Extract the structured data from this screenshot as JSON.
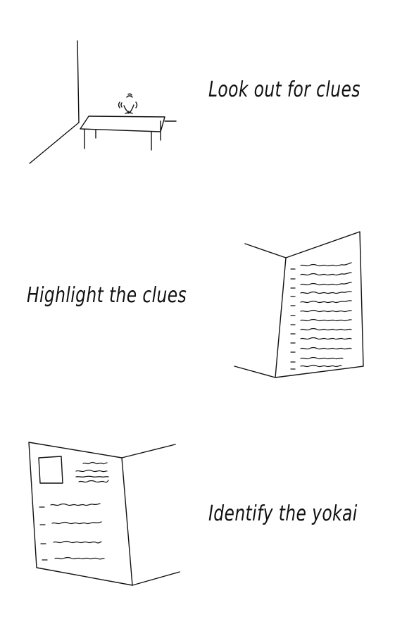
{
  "steps": [
    {
      "caption": "Look out for clues",
      "illustration": "room-corner-table-with-object-icon"
    },
    {
      "caption": "Highlight the clues",
      "illustration": "open-document-with-lines-icon"
    },
    {
      "caption": "Identify the yokai",
      "illustration": "open-file-with-photo-icon"
    }
  ],
  "colors": {
    "ink": "#111111",
    "background": "#ffffff"
  }
}
